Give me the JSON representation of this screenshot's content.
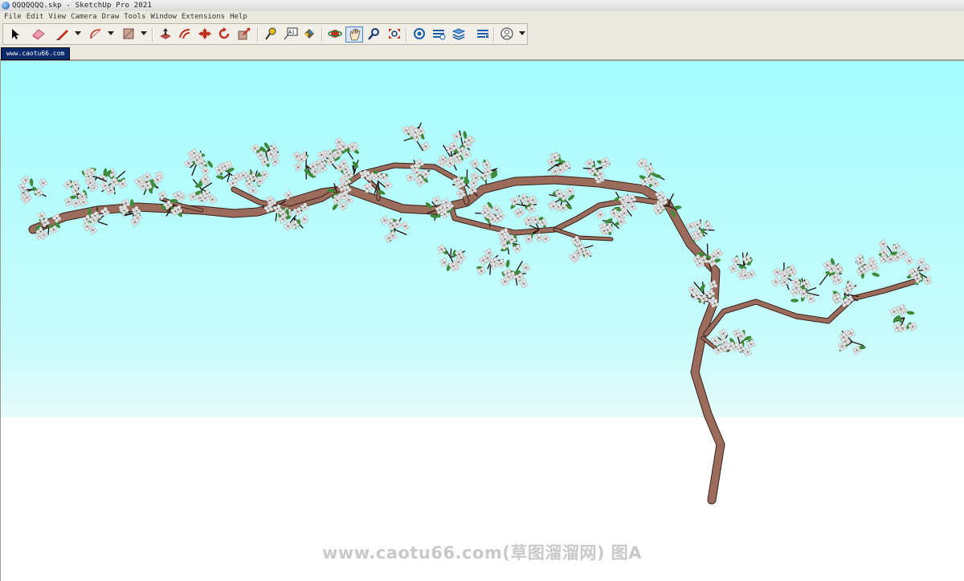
{
  "window": {
    "title": "QQQQQQQ.skp - SketchUp Pro 2021"
  },
  "menu": {
    "items": [
      "File",
      "Edit",
      "View",
      "Camera",
      "Draw",
      "Tools",
      "Window",
      "Extensions",
      "Help"
    ]
  },
  "toolbar": {
    "tools": [
      "select-icon",
      "eraser-icon",
      "pencil-line-icon",
      "arc-icon",
      "rectangle-icon",
      "push-pull-icon",
      "offset-icon",
      "move-icon",
      "rotate-icon",
      "scale-icon",
      "tape-measure-icon",
      "text-icon",
      "paint-bucket-icon",
      "orbit-icon",
      "pan-icon",
      "zoom-icon",
      "zoom-extents-icon",
      "warehouse-icon",
      "extension-warehouse-icon",
      "layout-icon",
      "extension-manager-icon",
      "account-icon"
    ],
    "active_tool": "pan-icon"
  },
  "tab": {
    "label": "www.caotu66.com"
  },
  "viewport": {
    "sky_color": "#a6fdfe",
    "ground_color": "#ffffff",
    "trunk_color": "#9b6b5c",
    "leaf_color": "#3f8a3a",
    "blossom_color": "#e4e4e4"
  },
  "watermark": {
    "text": "www.caotu66.com(草图溜溜网) 图A"
  }
}
